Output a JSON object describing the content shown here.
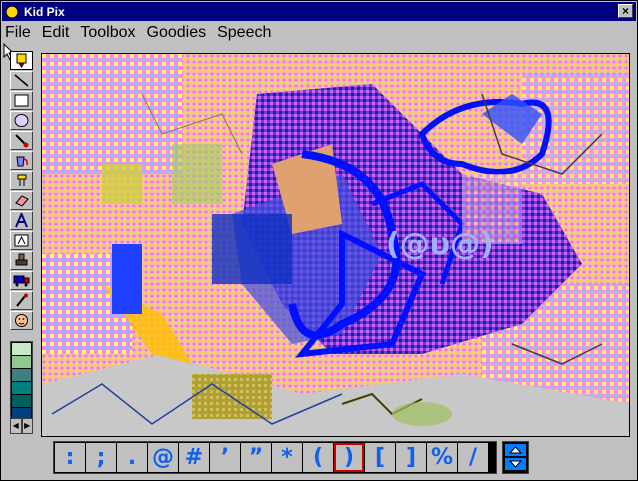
{
  "window": {
    "title": "Kid Pix",
    "close_label": "×"
  },
  "menu": [
    {
      "label": "File"
    },
    {
      "label": "Edit"
    },
    {
      "label": "Toolbox"
    },
    {
      "label": "Goodies"
    },
    {
      "label": "Speech"
    }
  ],
  "tools": [
    {
      "name": "wacky-pencil",
      "icon": "pencil-icon"
    },
    {
      "name": "line",
      "icon": "line-icon"
    },
    {
      "name": "rectangle",
      "icon": "rectangle-icon"
    },
    {
      "name": "oval",
      "icon": "oval-icon"
    },
    {
      "name": "wacky-brush",
      "icon": "brush-icon"
    },
    {
      "name": "paint-can",
      "icon": "paint-bucket-icon"
    },
    {
      "name": "electric-mixer",
      "icon": "mixer-icon"
    },
    {
      "name": "eraser",
      "icon": "eraser-icon"
    },
    {
      "name": "alphabet-text",
      "icon": "letter-a-icon"
    },
    {
      "name": "typewriter",
      "icon": "text-box-icon"
    },
    {
      "name": "rubber-stamp",
      "icon": "stamp-icon"
    },
    {
      "name": "moving-van",
      "icon": "truck-icon"
    },
    {
      "name": "eyedropper",
      "icon": "eyedropper-icon"
    },
    {
      "name": "undo-guy",
      "icon": "face-icon"
    }
  ],
  "palette": {
    "colors": [
      "#c8e8c8",
      "#90c890",
      "#408080",
      "#008080",
      "#006060",
      "#004080",
      "#00a0a0"
    ],
    "up_label": "◀",
    "down_label": "▶"
  },
  "glyph_strip": {
    "glyphs": [
      ":",
      ";",
      ".",
      "@",
      "#",
      "’",
      "”",
      "*",
      "(",
      ")",
      "[",
      "]",
      "%",
      "/"
    ],
    "selected_index": 9
  },
  "canvas_text": "(@υ@)",
  "accent": {
    "title_bar": "#000080",
    "glyph_color": "#1060f0",
    "selection": "#d00000"
  }
}
